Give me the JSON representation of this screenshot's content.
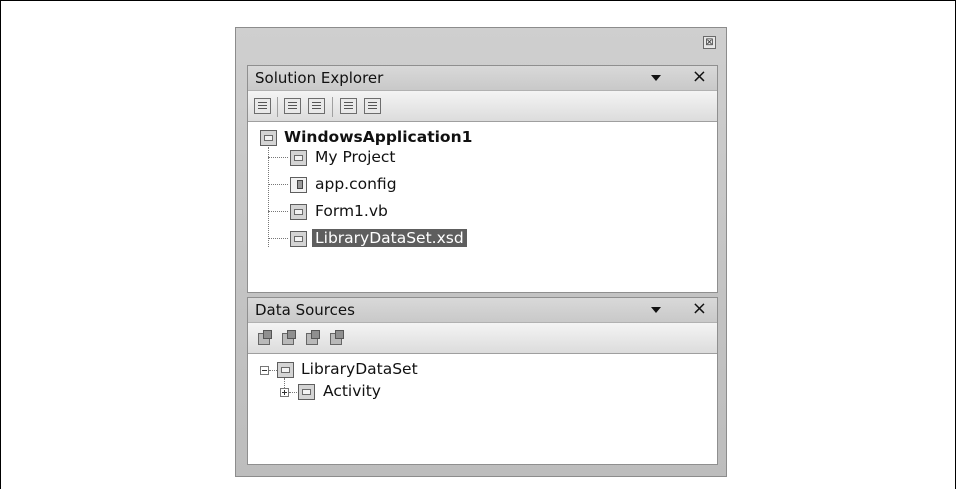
{
  "window": {
    "close_glyph": "⊠"
  },
  "solution_explorer": {
    "title": "Solution Explorer",
    "dropdown_icon": "chevron-down-icon",
    "close_label": "×",
    "toolbar_icons": [
      "properties-icon",
      "show-all-files-icon",
      "refresh-icon",
      "view-code-icon",
      "view-designer-icon"
    ],
    "root": {
      "label": "WindowsApplication1",
      "icon": "vb-project-icon"
    },
    "items": [
      {
        "label": "My Project",
        "icon": "my-project-icon"
      },
      {
        "label": "app.config",
        "icon": "config-file-icon"
      },
      {
        "label": "Form1.vb",
        "icon": "form-icon"
      },
      {
        "label": "LibraryDataSet.xsd",
        "icon": "dataset-xsd-icon",
        "selected": true
      }
    ]
  },
  "data_sources": {
    "title": "Data Sources",
    "dropdown_icon": "chevron-down-icon",
    "close_label": "×",
    "toolbar_icons": [
      "add-data-source-icon",
      "edit-dataset-icon",
      "configure-dataset-icon",
      "refresh-datasource-icon"
    ],
    "tree": [
      {
        "label": "LibraryDataSet",
        "icon": "dataset-icon",
        "expanded": true
      },
      {
        "label": "Activity",
        "icon": "datatable-icon",
        "expanded": false
      }
    ]
  }
}
